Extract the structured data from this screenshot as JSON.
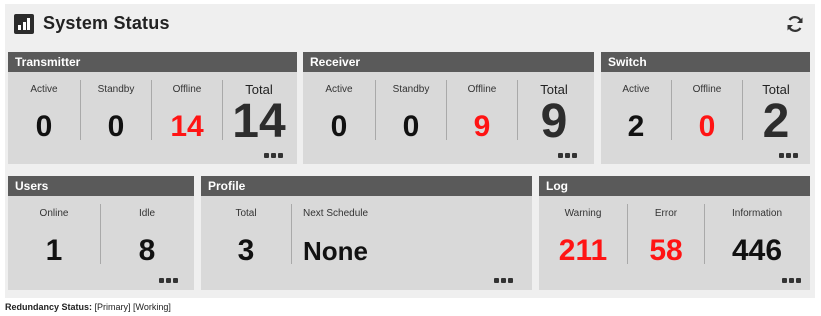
{
  "header": {
    "title": "System Status",
    "logo_icon": "bar-chart-icon",
    "refresh_icon": "refresh-icon"
  },
  "transmitter": {
    "title": "Transmitter",
    "active": {
      "label": "Active",
      "value": "0"
    },
    "standby": {
      "label": "Standby",
      "value": "0"
    },
    "offline": {
      "label": "Offline",
      "value": "14"
    },
    "total": {
      "label": "Total",
      "value": "14"
    }
  },
  "receiver": {
    "title": "Receiver",
    "active": {
      "label": "Active",
      "value": "0"
    },
    "standby": {
      "label": "Standby",
      "value": "0"
    },
    "offline": {
      "label": "Offline",
      "value": "9"
    },
    "total": {
      "label": "Total",
      "value": "9"
    }
  },
  "switch": {
    "title": "Switch",
    "active": {
      "label": "Active",
      "value": "2"
    },
    "offline": {
      "label": "Offline",
      "value": "0"
    },
    "total": {
      "label": "Total",
      "value": "2"
    }
  },
  "users": {
    "title": "Users",
    "online": {
      "label": "Online",
      "value": "1"
    },
    "idle": {
      "label": "Idle",
      "value": "8"
    }
  },
  "profile": {
    "title": "Profile",
    "total": {
      "label": "Total",
      "value": "3"
    },
    "next_schedule": {
      "label": "Next Schedule",
      "value": "None"
    }
  },
  "log": {
    "title": "Log",
    "warning": {
      "label": "Warning",
      "value": "211"
    },
    "error": {
      "label": "Error",
      "value": "58"
    },
    "information": {
      "label": "Information",
      "value": "446"
    }
  },
  "footer": {
    "label": "Redundancy Status:",
    "value": "[Primary] [Working]"
  },
  "colors": {
    "panel_header": "#5a5a5a",
    "panel_body": "#d9d9d9",
    "alert": "#ff1414"
  }
}
